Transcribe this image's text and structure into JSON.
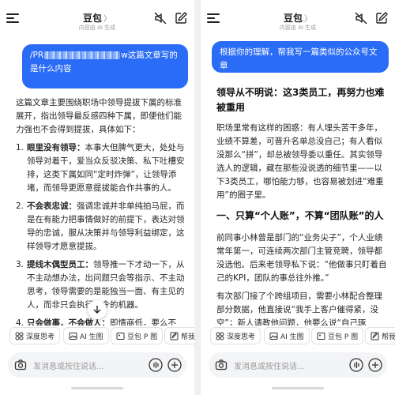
{
  "left": {
    "header": {
      "title": "豆包",
      "chevron": "〉",
      "subtitle": "内容由 AI 生成"
    },
    "user_message": {
      "text_prefix": "/PR",
      "text_middle": "w",
      "text_suffix": "这篇文章写的是什么内容"
    },
    "answer": {
      "intro": "这篇文章主要围绕职场中领导提拔下属的标准展开，指出领导最反感四种下属，即便他们能力强也不会得到提拔，具体如下：",
      "items": [
        {
          "num": "1.",
          "title": "眼里没有领导：",
          "text": "本事大但脾气更大，处处与领导对着干，爱当众反驳决策、私下吐槽安排，这类下属如同“定时炸弹”，让领导添堵，而领导更愿意提拔能合作共事的人。"
        },
        {
          "num": "2.",
          "title": "不会表忠诚：",
          "text": "强调忠诚并非单纯拍马屁，而是在有能力把事情做好的前提下，表达对领导的忠诚，服从决策并与领导利益绑定，这样领导才愿意提拔。"
        },
        {
          "num": "3.",
          "title": "提线木偶型员工：",
          "text": "领导推一下才动一下，从不主动想办法，出问题只会等指示、不主动思考，领导需要的是能独当一面、有主见的人，而非只会执行命令的机器。"
        },
        {
          "num": "4.",
          "title": "只会做事，不会做人：",
          "text": "即情商低，要么不"
        }
      ]
    },
    "chips": [
      {
        "icon": "deep-think-icon",
        "label": "深度思考"
      },
      {
        "icon": "ai-image-icon",
        "label": "AI 生图"
      },
      {
        "icon": "doubao-p-image-icon",
        "label": "豆包 P 图"
      },
      {
        "icon": "help-write-icon",
        "label": "帮我写"
      }
    ],
    "input": {
      "placeholder": "发消息或按住说话..."
    }
  },
  "right": {
    "header": {
      "title": "豆包",
      "chevron": "〉",
      "subtitle": "内容由 AI 生成"
    },
    "user_message": {
      "text": "根据你的理解，帮我写一篇类似的公众号文章"
    },
    "answer": {
      "title": "领导从不明说：这3类员工，再努力也难被重用",
      "p1": "职场里常有这样的困惑：有人埋头苦干多年，业绩不算差，可晋升名单总没自己；有人看似没那么“拼”，却总被领导委以重任。其实领导选人的逻辑，藏在那些没说透的细节里——以下3类员工，哪怕能力够，也容易被划进“难重用”的圈子里。",
      "h2": "一、只算“个人账”，不算“团队账”的人",
      "p2": "前同事小林曾是部门的“业务尖子”，个人业绩常年第一，可连续两次部门主管竞聘，领导都没选他。后来老领导私下说：“他做事只盯着自己的KPI，团队的事总往外推。”",
      "p3": "有次部门接了个跨组项目，需要小林配合整理部分数据，他直接说“我手上客户催得紧，没空”；新人请教他问题，他要么说“自己琢"
    },
    "chips": [
      {
        "icon": "deep-think-icon",
        "label": "深度思考"
      },
      {
        "icon": "ai-image-icon",
        "label": "AI 生图"
      },
      {
        "icon": "doubao-p-image-icon",
        "label": "豆包 P 图"
      },
      {
        "icon": "help-write-icon",
        "label": "帮我写"
      }
    ],
    "input": {
      "placeholder": "发消息或按住说话..."
    }
  },
  "colors": {
    "accent": "#2b6cf6",
    "text": "#262626",
    "placeholder": "#9a9a9a"
  }
}
